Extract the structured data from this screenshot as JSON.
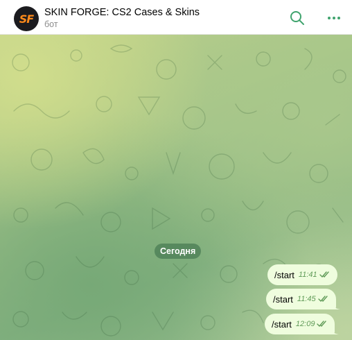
{
  "header": {
    "avatar_text": "SF",
    "title": "SKIN FORGE: CS2 Cases & Skins",
    "subtitle": "бот",
    "icons": [
      "search-icon",
      "more-dots-icon"
    ],
    "accent": "#3fa36d"
  },
  "chat": {
    "date_label": "Сегодня",
    "messages": [
      {
        "text": "/start",
        "time": "11:41",
        "status": "read"
      },
      {
        "text": "/start",
        "time": "11:45",
        "status": "read"
      },
      {
        "text": "/start",
        "time": "12:09",
        "status": "read"
      }
    ],
    "bubble_color": "#effdde",
    "time_color": "#5f9a57"
  }
}
